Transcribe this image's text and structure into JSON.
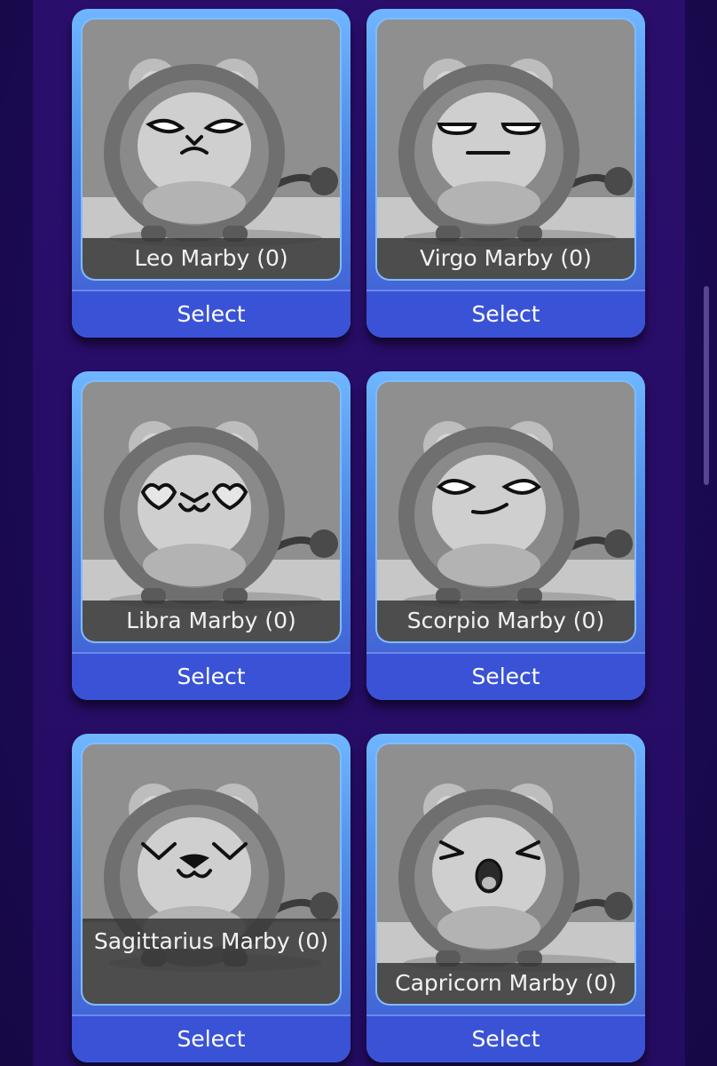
{
  "cards": [
    {
      "name": "Leo Marby (0)",
      "button": "Select",
      "eyes": "angry"
    },
    {
      "name": "Virgo Marby (0)",
      "button": "Select",
      "eyes": "bored"
    },
    {
      "name": "Libra Marby (0)",
      "button": "Select",
      "eyes": "hearts"
    },
    {
      "name": "Scorpio Marby (0)",
      "button": "Select",
      "eyes": "smug"
    },
    {
      "name": "Sagittarius Marby (0)",
      "button": "Select",
      "eyes": "happy"
    },
    {
      "name": "Capricorn Marby (0)",
      "button": "Select",
      "eyes": "yawn"
    }
  ],
  "colors": {
    "background": "#1c0a55",
    "card_border": "#5aa9ff",
    "button": "#3a53d6",
    "name_band": "#373737"
  }
}
